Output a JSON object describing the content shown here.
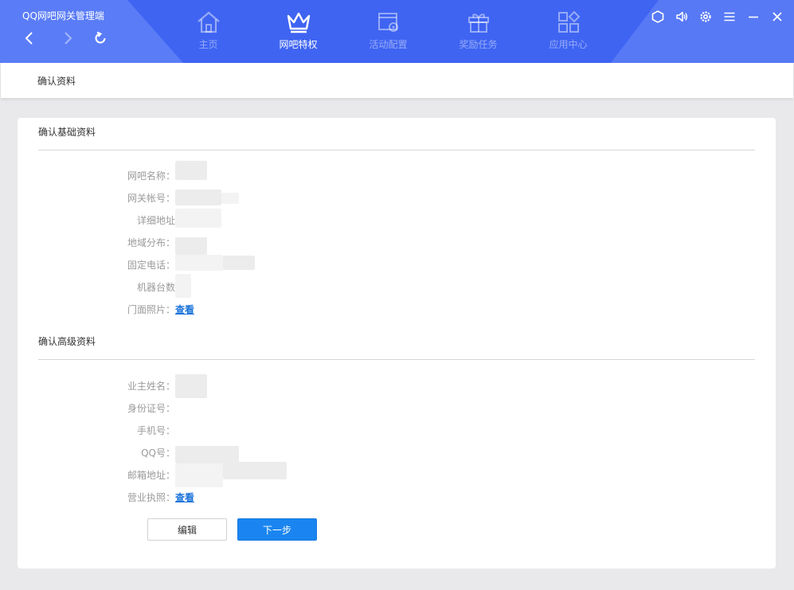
{
  "app": {
    "title": "QQ网吧网关管理端"
  },
  "tabs": [
    {
      "label": "主页",
      "icon": "home-icon",
      "active": false
    },
    {
      "label": "网吧特权",
      "icon": "crown-icon",
      "active": true
    },
    {
      "label": "活动配置",
      "icon": "activity-config-icon",
      "active": false
    },
    {
      "label": "奖励任务",
      "icon": "gift-icon",
      "active": false
    },
    {
      "label": "应用中心",
      "icon": "apps-icon",
      "active": false
    }
  ],
  "window_controls": [
    "cube-icon",
    "speaker-icon",
    "gear-icon",
    "menu-icon",
    "minimize-icon",
    "close-icon"
  ],
  "breadcrumb": "确认资料",
  "basic": {
    "title": "确认基础资料",
    "fields": [
      {
        "label": "网吧名称：",
        "value": ""
      },
      {
        "label": "网关帐号：",
        "value": ""
      },
      {
        "label": "详细地址",
        "value": ""
      },
      {
        "label": "地域分布：",
        "value": ""
      },
      {
        "label": "固定电话：",
        "value": ""
      },
      {
        "label": "机器台数",
        "value": ""
      }
    ],
    "photo_label": "门面照片：",
    "photo_link": "查看"
  },
  "advanced": {
    "title": "确认高级资料",
    "fields": [
      {
        "label": "业主姓名：",
        "value": ""
      },
      {
        "label": "身份证号：",
        "value": ""
      },
      {
        "label": "手机号：",
        "value": ""
      },
      {
        "label": "QQ号：",
        "value": ""
      },
      {
        "label": "邮箱地址：",
        "value": ""
      }
    ],
    "license_label": "营业执照：",
    "license_link": "查看"
  },
  "buttons": {
    "edit": "编辑",
    "next": "下一步"
  },
  "colors": {
    "topbar": "#3f64f2",
    "primary_button": "#1a85f0",
    "link": "#1a73d9"
  }
}
